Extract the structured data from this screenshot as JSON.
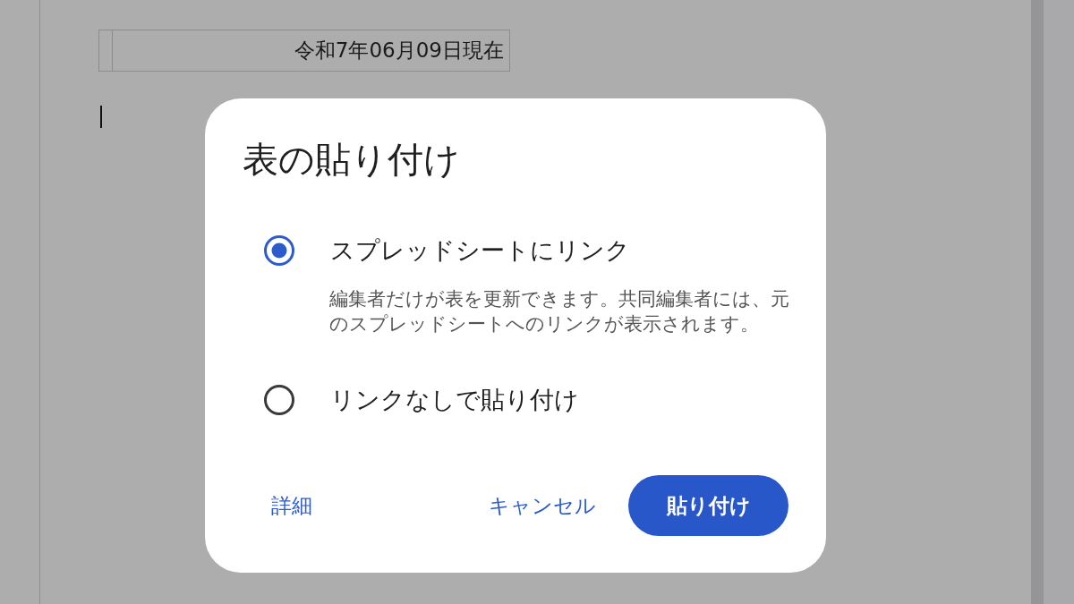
{
  "document": {
    "date_cell": "令和7年06月09日現在",
    "cursor_visible": true
  },
  "dialog": {
    "title": "表の貼り付け",
    "options": [
      {
        "label": "スプレッドシートにリンク",
        "selected": true,
        "description": "編集者だけが表を更新できます。共同編集者には、元のスプレッドシートへのリンクが表示されます。"
      },
      {
        "label": "リンクなしで貼り付け",
        "selected": false
      }
    ],
    "buttons": [
      {
        "label": "詳細",
        "kind": "text"
      },
      {
        "label": "キャンセル",
        "kind": "text"
      },
      {
        "label": "貼り付け",
        "kind": "filled"
      }
    ]
  }
}
